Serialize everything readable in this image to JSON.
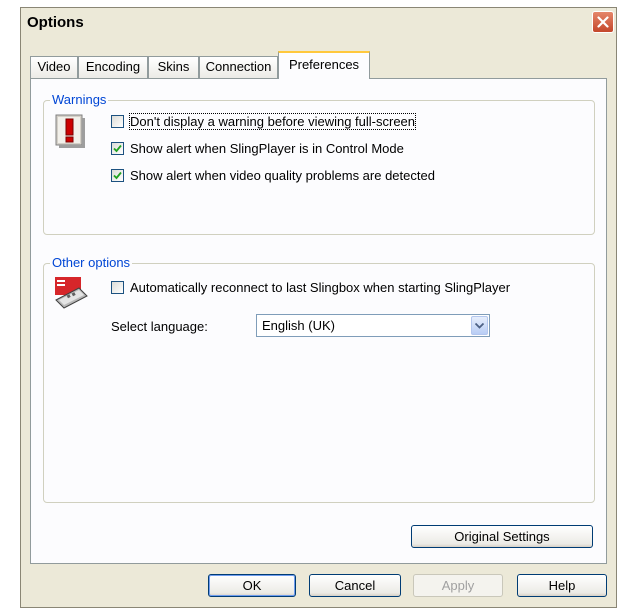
{
  "window": {
    "title": "Options",
    "close_icon": "close-icon"
  },
  "tabs": [
    {
      "label": "Video",
      "active": false
    },
    {
      "label": "Encoding",
      "active": false
    },
    {
      "label": "Skins",
      "active": false
    },
    {
      "label": "Connection",
      "active": false
    },
    {
      "label": "Preferences",
      "active": true
    }
  ],
  "warnings": {
    "group_label": "Warnings",
    "icon": "warning-exclamation-icon",
    "items": [
      {
        "label": "Don't display a warning before viewing full-screen",
        "checked": false
      },
      {
        "label": "Show alert when SlingPlayer is in Control Mode",
        "checked": true
      },
      {
        "label": "Show alert when video quality problems are detected",
        "checked": true
      }
    ]
  },
  "other_options": {
    "group_label": "Other options",
    "icon": "remote-control-icon",
    "reconnect": {
      "label": "Automatically reconnect to last Slingbox when starting SlingPlayer",
      "checked": false
    },
    "language_label": "Select language:",
    "language_value": "English (UK)"
  },
  "buttons": {
    "original_settings": "Original Settings",
    "ok": "OK",
    "cancel": "Cancel",
    "apply": "Apply",
    "help": "Help"
  },
  "colors": {
    "dialog_bg": "#ECE9D8",
    "group_label": "#0046D5",
    "close_button": "#D9542F",
    "tab_highlight": "#FFC83C"
  }
}
